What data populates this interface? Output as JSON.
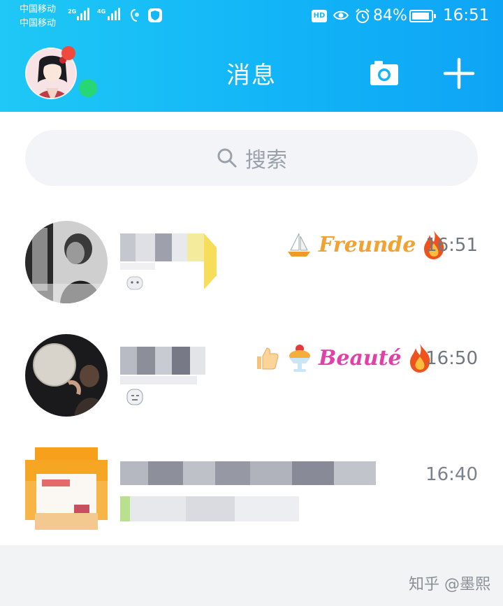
{
  "status_bar": {
    "carrier_line1": "中国移动",
    "carrier_line2": "中国移动",
    "net1": "2G",
    "net2": "4G",
    "hd": "HD",
    "battery": "84%",
    "battery_fraction": 0.84,
    "time": "16:51"
  },
  "header": {
    "title": "消息",
    "avatar_icon": "profile-avatar",
    "camera_icon": "camera-icon",
    "add_icon": "plus-icon"
  },
  "search": {
    "placeholder": "搜索",
    "icon": "search-icon"
  },
  "conversations": [
    {
      "time": "16:51",
      "badges": [
        "sailboat-icon",
        "Freunde",
        "fire-icon"
      ]
    },
    {
      "time": "16:50",
      "badges": [
        "thumbs-up-icon",
        "ice-cream-icon",
        "Beauté",
        "fire-icon"
      ]
    },
    {
      "time": "16:40",
      "badges": []
    }
  ],
  "watermark": "知乎 @墨熙",
  "colors": {
    "header": "#12b5f7",
    "badge_red": "#f04a3e",
    "online_green": "#27d675"
  }
}
